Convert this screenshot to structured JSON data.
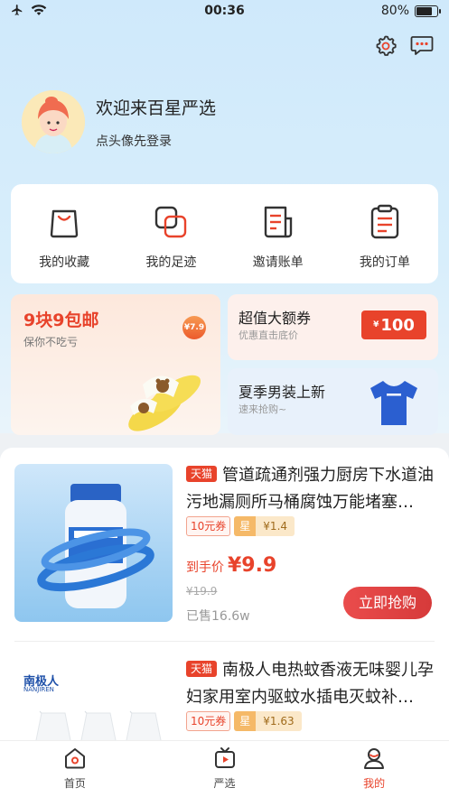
{
  "status_bar": {
    "time": "00:36",
    "battery": "80%",
    "battery_level": 0.8
  },
  "profile": {
    "welcome": "欢迎来百星严选",
    "login_hint": "点头像先登录"
  },
  "quick_actions": [
    {
      "label": "我的收藏",
      "icon": "shopping-bag-icon"
    },
    {
      "label": "我的足迹",
      "icon": "footprint-icon"
    },
    {
      "label": "邀请账单",
      "icon": "invite-bill-icon"
    },
    {
      "label": "我的订单",
      "icon": "order-clipboard-icon"
    }
  ],
  "promos": {
    "left": {
      "title": "9块9包邮",
      "subtitle": "保你不吃亏",
      "price_tag": "¥7.9"
    },
    "right_top": {
      "title": "超值大额券",
      "subtitle": "优惠直击底价",
      "coupon_currency": "¥",
      "coupon_value": "100"
    },
    "right_bottom": {
      "title": "夏季男装上新",
      "subtitle": "速来抢购~"
    }
  },
  "products": [
    {
      "badge": "天猫",
      "title": "管道疏通剂强力厨房下水道油污地漏厕所马桶腐蚀万能堵塞…",
      "coupon": "10元券",
      "star_label": "星",
      "star_value": "¥1.4",
      "price_label": "到手价",
      "price": "¥9.9",
      "original_price": "¥19.9",
      "sold": "已售16.6w",
      "buy_label": "立即抢购"
    },
    {
      "badge": "天猫",
      "title": "南极人电热蚊香液无味婴儿孕妇家用室内驱蚊水插电灭蚊补…",
      "coupon": "10元券",
      "star_label": "星",
      "star_value": "¥1.63",
      "brand_text": "南极人",
      "brand_sub": "NANJIREN"
    }
  ],
  "tabs": [
    {
      "label": "首页",
      "icon": "home-icon",
      "active": false
    },
    {
      "label": "严选",
      "icon": "tv-play-icon",
      "active": false
    },
    {
      "label": "我的",
      "icon": "user-icon",
      "active": true
    }
  ],
  "colors": {
    "accent": "#e8432b",
    "hero_bg": "#d3ebfa",
    "card_bg": "#ffffff"
  }
}
